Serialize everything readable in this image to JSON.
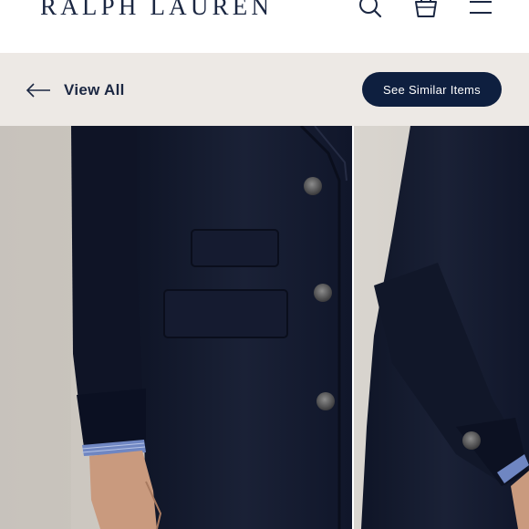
{
  "header": {
    "brand": "RALPH LAUREN",
    "icons": [
      "search-icon",
      "shopping-bag-icon",
      "hamburger-menu-icon"
    ]
  },
  "subbar": {
    "back_label": "View All",
    "similar_label": "See Similar Items"
  },
  "gallery": {
    "images": [
      {
        "subject": "navy wool coat front detail"
      },
      {
        "subject": "navy wool coat side view"
      }
    ]
  },
  "colors": {
    "brand_navy": "#1b2742",
    "button_navy": "#0e1f3f",
    "subbar_bg": "#ede9e5",
    "coat": "#141a2e"
  }
}
